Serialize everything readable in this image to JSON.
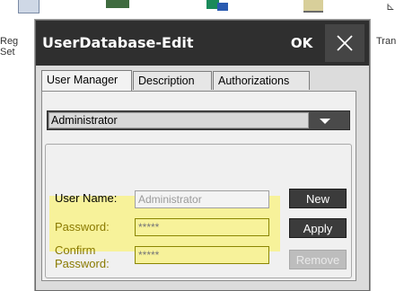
{
  "desktop": {
    "left_labels": [
      "Reg",
      "Set"
    ],
    "right_label": "Tran"
  },
  "window": {
    "title": "UserDatabase-Edit",
    "ok_label": "OK"
  },
  "tabs": [
    {
      "label": "User Manager",
      "active": true
    },
    {
      "label": "Description",
      "active": false
    },
    {
      "label": "Authorizations",
      "active": false
    }
  ],
  "user_select": {
    "selected": "Administrator"
  },
  "form": {
    "user_name_label": "User Name:",
    "user_name_value": "Administrator",
    "password_label": "Password:",
    "password_value": "*****",
    "confirm_label_1": "Confirm",
    "confirm_label_2": "Password:",
    "confirm_value": "*****"
  },
  "buttons": {
    "new": "New",
    "apply": "Apply",
    "remove": "Remove"
  },
  "colors": {
    "highlight": "#f7f29a",
    "titlebar": "#2f2f2f"
  }
}
